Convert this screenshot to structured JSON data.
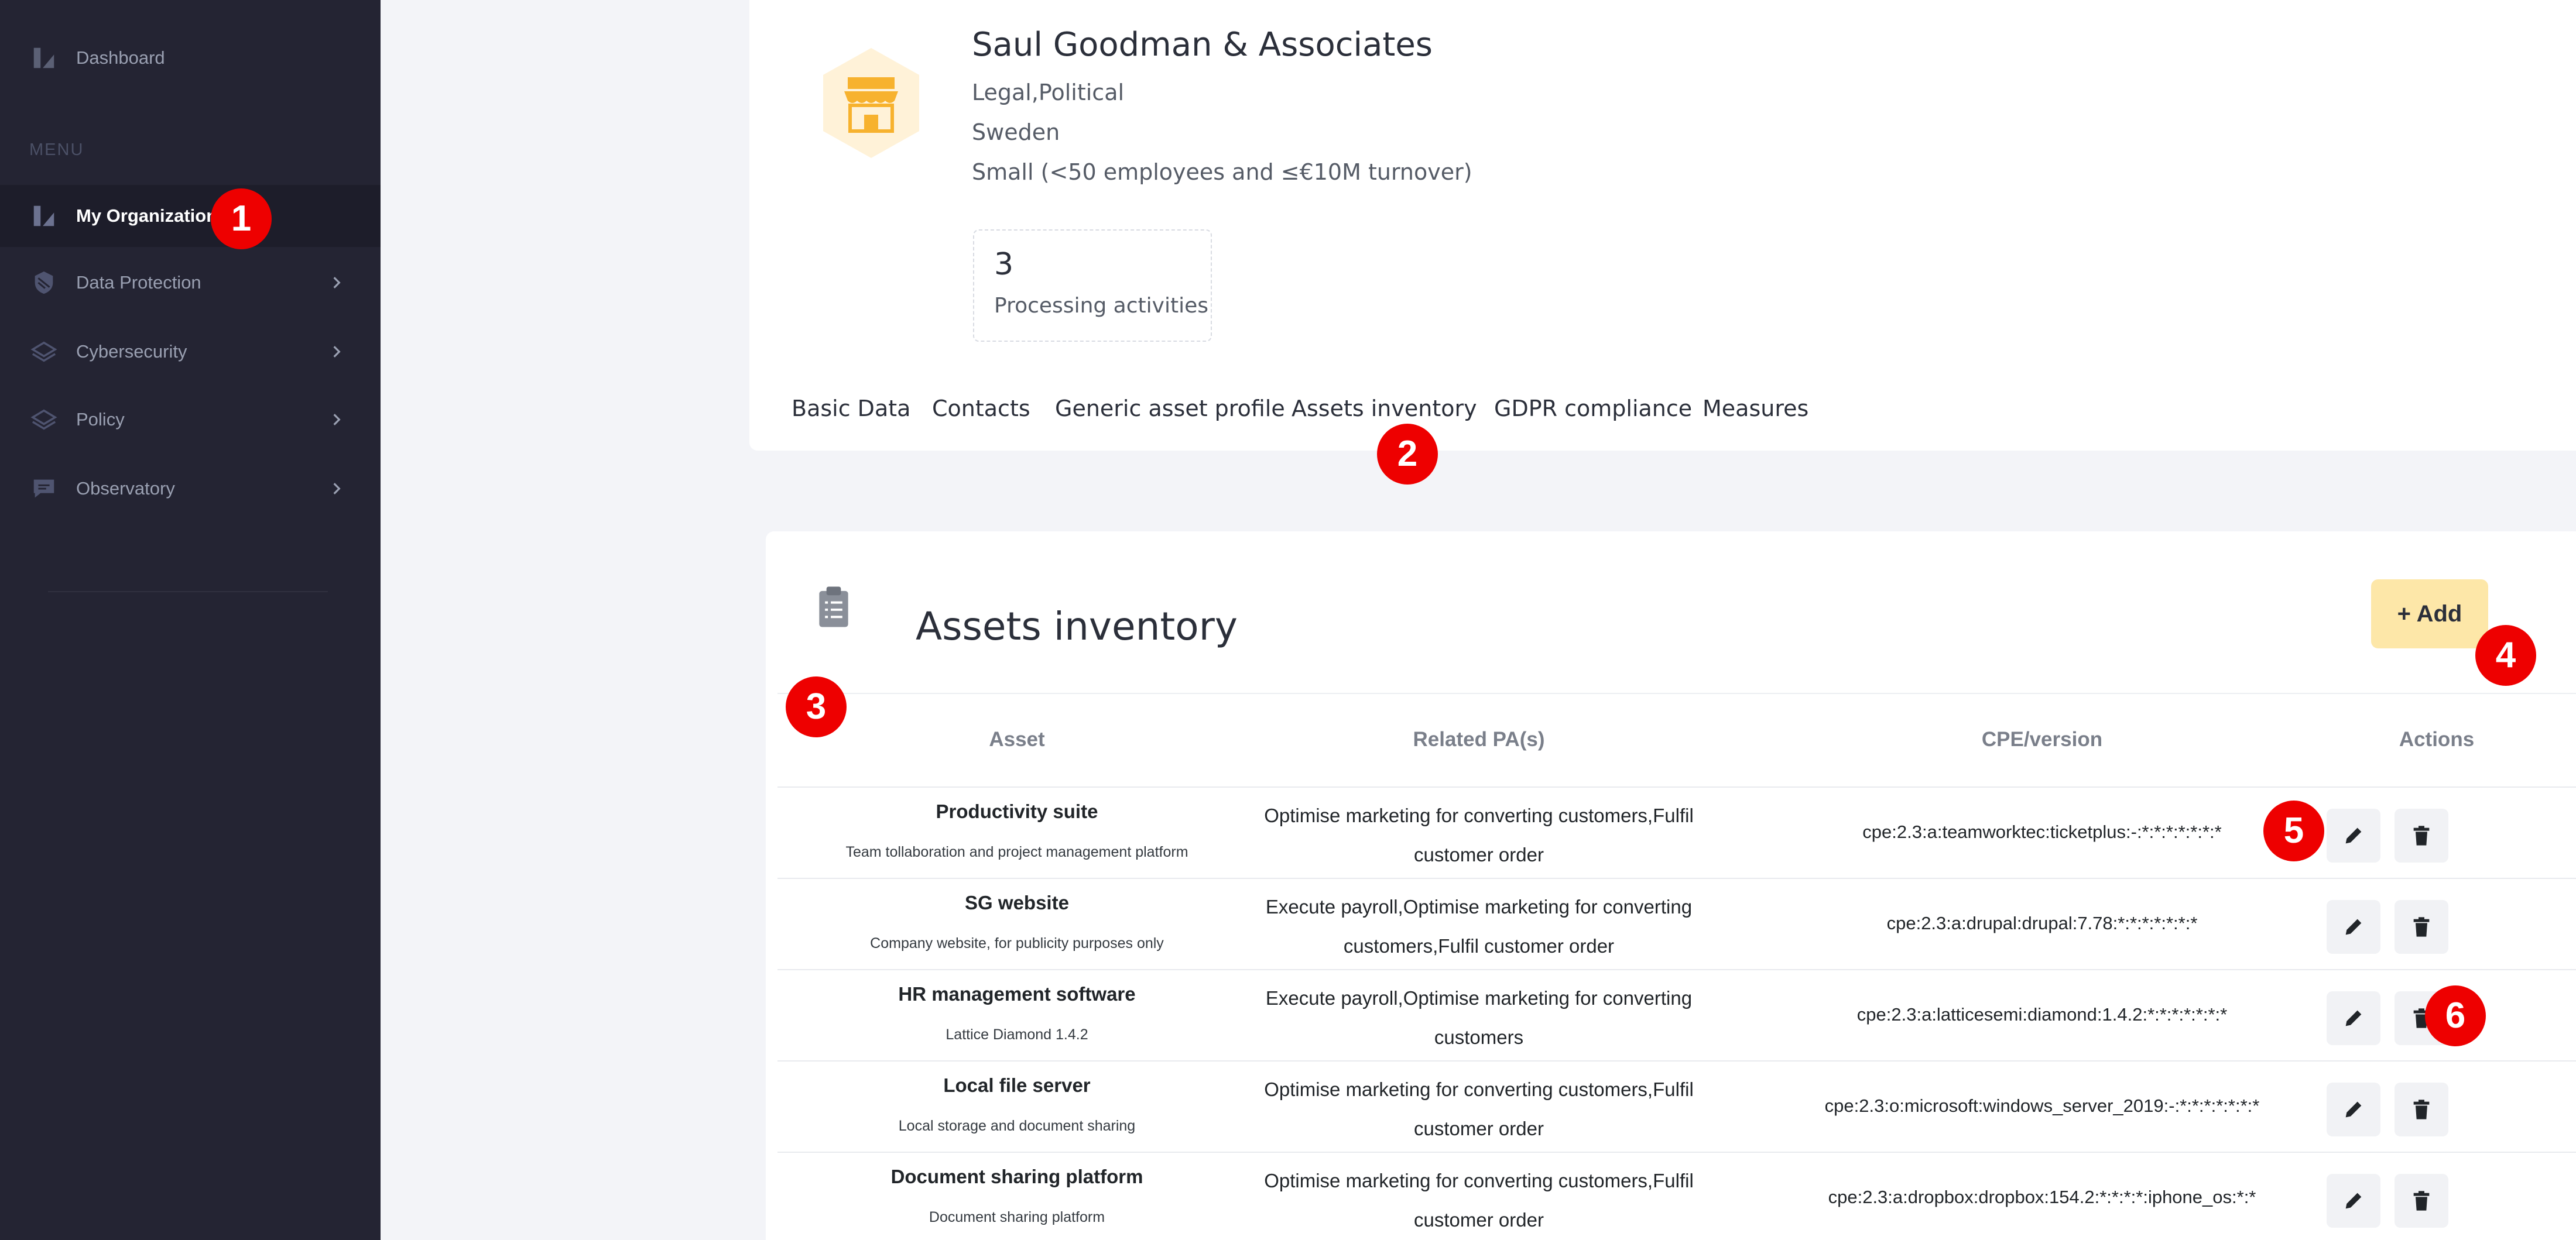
{
  "sidebar": {
    "dashboard": "Dashboard",
    "menu_heading": "MENU",
    "items": [
      {
        "label": "My Organization",
        "icon": "organization-icon",
        "active": true
      },
      {
        "label": "Data Protection",
        "icon": "shield-icon"
      },
      {
        "label": "Cybersecurity",
        "icon": "layers-icon"
      },
      {
        "label": "Policy",
        "icon": "layers-icon"
      },
      {
        "label": "Observatory",
        "icon": "chat-icon"
      }
    ]
  },
  "organization": {
    "name": "Saul Goodman & Associates",
    "sector": "Legal,Political",
    "country": "Sweden",
    "size": "Small (<50 employees and ≤€10M turnover)",
    "processing_count": "3",
    "processing_label": "Processing activities"
  },
  "tabs": [
    "Basic Data",
    "Contacts",
    "Generic asset profile",
    "Assets inventory",
    "GDPR compliance",
    "Measures"
  ],
  "assets": {
    "title": "Assets inventory",
    "add_label": "+ Add",
    "columns": [
      "Asset",
      "Related PA(s)",
      "CPE/version",
      "Actions"
    ],
    "rows": [
      {
        "name": "Productivity suite",
        "description": "Team tollaboration and project management platform",
        "related_pa_line1": "Optimise marketing for converting customers,Fulfil",
        "related_pa_line2": "customer order",
        "cpe": "cpe:2.3:a:teamworktec:ticketplus:-:*:*:*:*:*:*:*"
      },
      {
        "name": "SG website",
        "description": "Company website, for publicity purposes only",
        "related_pa_line1": "Execute payroll,Optimise marketing for converting",
        "related_pa_line2": "customers,Fulfil customer order",
        "cpe": "cpe:2.3:a:drupal:drupal:7.78:*:*:*:*:*:*:*"
      },
      {
        "name": "HR management software",
        "description": "Lattice Diamond 1.4.2",
        "related_pa_line1": "Execute payroll,Optimise marketing for converting",
        "related_pa_line2": "customers",
        "cpe": "cpe:2.3:a:latticesemi:diamond:1.4.2:*:*:*:*:*:*:*"
      },
      {
        "name": "Local file server",
        "description": "Local storage and document sharing",
        "related_pa_line1": "Optimise marketing for converting customers,Fulfil",
        "related_pa_line2": "customer order",
        "cpe": "cpe:2.3:o:microsoft:windows_server_2019:-:*:*:*:*:*:*:*"
      },
      {
        "name": "Document sharing platform",
        "description": "Document sharing platform",
        "related_pa_line1": "Optimise marketing for converting customers,Fulfil",
        "related_pa_line2": "customer order",
        "cpe": "cpe:2.3:a:dropbox:dropbox:154.2:*:*:*:*:iphone_os:*:*"
      }
    ]
  },
  "annotations": [
    "1",
    "2",
    "3",
    "4",
    "5",
    "6"
  ],
  "colors": {
    "sidebar": "#242433",
    "accent_add": "#fde7a8",
    "badge": "#ee0000",
    "avatar_bg": "#fff2d8",
    "avatar_icon": "#f7b22e"
  }
}
